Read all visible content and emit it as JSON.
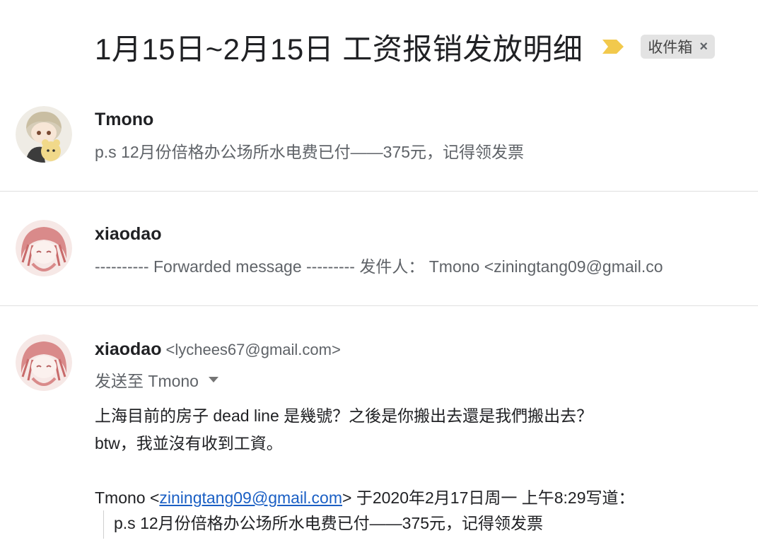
{
  "thread": {
    "subject": "1月15日~2月15日 工资报销发放明细",
    "label": "收件箱",
    "label_remove": "×",
    "importance_icon": "importance-marker-icon",
    "importance_color": "#f2c94c"
  },
  "messages": [
    {
      "sender": "Tmono",
      "snippet": "p.s 12月份倍格办公场所水电费已付——375元，记得领发票"
    },
    {
      "sender": "xiaodao",
      "snippet": "---------- Forwarded message --------- 发件人：  Tmono <ziningtang09@gmail.co"
    },
    {
      "sender": "xiaodao",
      "sender_email": "<lychees67@gmail.com>",
      "to_label": "发送至 Tmono",
      "body_lines": [
        "上海目前的房子 dead line 是幾號？之後是你搬出去還是我們搬出去？",
        "btw，我並沒有收到工資。"
      ],
      "quote_header_prefix": "Tmono <",
      "quote_header_email": "ziningtang09@gmail.com",
      "quote_header_suffix": "> 于2020年2月17日周一 上午8:29写道：",
      "quoted_text": "p.s 12月份倍格办公场所水电费已付——375元，记得领发票"
    }
  ],
  "colors": {
    "link": "#1a5fc4",
    "secondary_text": "#5f6368",
    "divider": "#e0e0e0"
  }
}
